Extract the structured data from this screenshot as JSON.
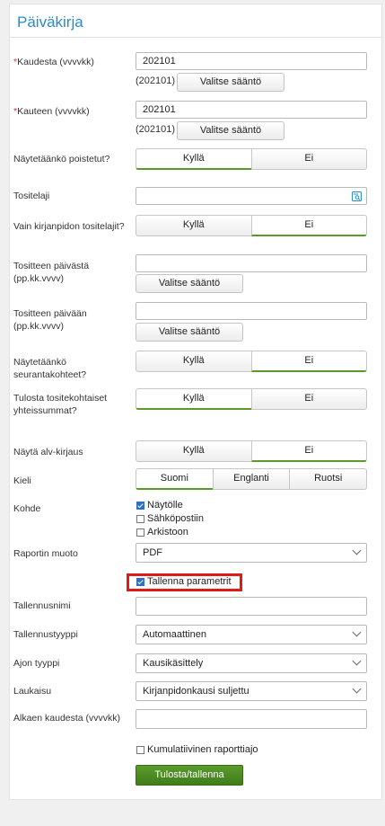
{
  "header": {
    "title": "Päiväkirja"
  },
  "fields": {
    "kaudesta": {
      "label": "Kaudesta (vvvvkk)",
      "value": "202101",
      "hint": "(202101)",
      "rule_button": "Valitse sääntö"
    },
    "kauteen": {
      "label": "Kauteen (vvvvkk)",
      "value": "202101",
      "hint": "(202101)",
      "rule_button": "Valitse sääntö"
    },
    "poistetut": {
      "label": "Näytetäänkö poistetut?",
      "yes": "Kyllä",
      "no": "Ei",
      "selected": "yes"
    },
    "tositelaji": {
      "label": "Tositelaji",
      "value": "",
      "icon": "search-list-icon"
    },
    "vain_kirjanpidon": {
      "label": "Vain kirjanpidon tositelajit?",
      "yes": "Kyllä",
      "no": "Ei",
      "selected": "no"
    },
    "paivasta": {
      "label": "Tositteen päivästä (pp.kk.vvvv)",
      "value": "",
      "rule_button": "Valitse sääntö"
    },
    "paivaan": {
      "label": "Tositteen päivään (pp.kk.vvvv)",
      "value": "",
      "rule_button": "Valitse sääntö"
    },
    "seurantakohteet": {
      "label": "Näytetäänkö seurantakohteet?",
      "yes": "Kyllä",
      "no": "Ei",
      "selected": "no"
    },
    "yhteissummat": {
      "label": "Tulosta tositekohtaiset yhteissummat?",
      "yes": "Kyllä",
      "no": "Ei",
      "selected": "yes"
    },
    "alv": {
      "label": "Näytä alv-kirjaus",
      "yes": "Kyllä",
      "no": "Ei",
      "selected": "no"
    },
    "kieli": {
      "label": "Kieli",
      "options": [
        "Suomi",
        "Englanti",
        "Ruotsi"
      ],
      "selected": "Suomi"
    },
    "kohde": {
      "label": "Kohde",
      "options": [
        {
          "label": "Näytölle",
          "checked": true
        },
        {
          "label": "Sähköpostiin",
          "checked": false
        },
        {
          "label": "Arkistoon",
          "checked": false
        }
      ]
    },
    "raportin_muoto": {
      "label": "Raportin muoto",
      "value": "PDF"
    },
    "tallenna_parametrit": {
      "label": "Tallenna parametrit",
      "checked": true
    },
    "tallennusnimi": {
      "label": "Tallennusnimi",
      "value": ""
    },
    "tallennustyyppi": {
      "label": "Tallennustyyppi",
      "value": "Automaattinen"
    },
    "ajon_tyyppi": {
      "label": "Ajon tyyppi",
      "value": "Kausikäsittely"
    },
    "laukaisu": {
      "label": "Laukaisu",
      "value": "Kirjanpidonkausi suljettu"
    },
    "alkaen_kaudesta": {
      "label": "Alkaen kaudesta (vvvvkk)",
      "value": ""
    },
    "kumulatiivinen": {
      "label": "Kumulatiivinen raporttiajo",
      "checked": false
    }
  },
  "actions": {
    "submit": "Tulosta/tallenna"
  },
  "colors": {
    "accent": "#2a8bc7",
    "primary_button": "#4a8c22",
    "selected_underline": "#5a9a2a",
    "highlight": "#e01a1a",
    "required": "#d33"
  }
}
